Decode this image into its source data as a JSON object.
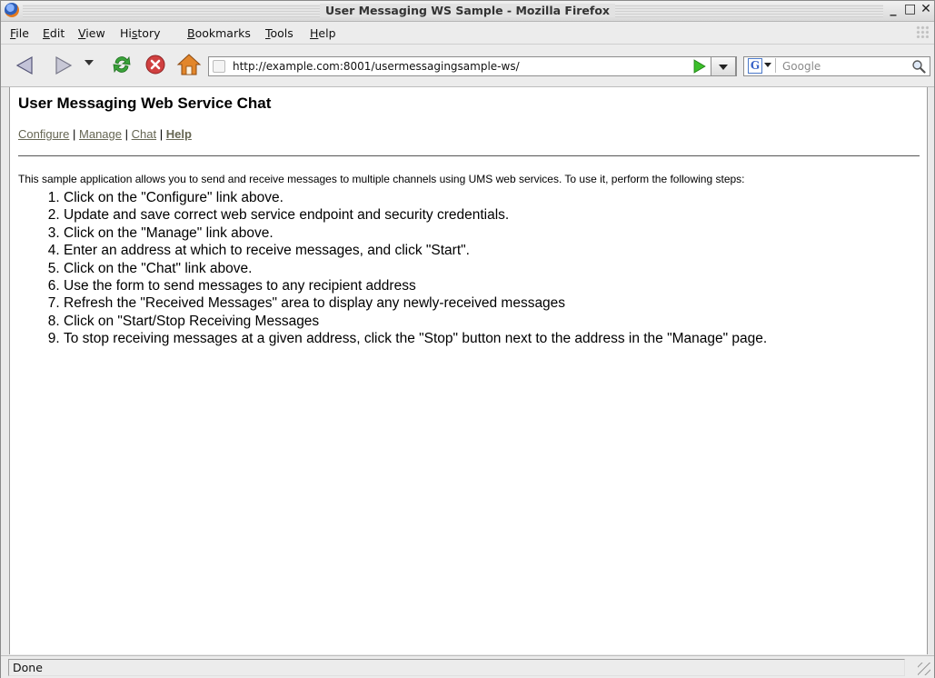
{
  "window": {
    "title": "User Messaging WS Sample - Mozilla Firefox",
    "controls": {
      "minimize": "_",
      "maximize": "□",
      "close": "✕"
    }
  },
  "menu": {
    "items": [
      "File",
      "Edit",
      "View",
      "History",
      "Bookmarks",
      "Tools",
      "Help"
    ]
  },
  "toolbar": {
    "url": "http://example.com:8001/usermessagingsample-ws/",
    "search_placeholder": "Google",
    "search_engine_letter": "G",
    "icons": [
      "back-icon",
      "forward-icon",
      "history-dropdown-icon",
      "reload-icon",
      "stop-icon",
      "home-icon",
      "go-icon",
      "search-icon"
    ]
  },
  "page": {
    "heading": "User Messaging Web Service Chat",
    "links": [
      {
        "label": "Configure"
      },
      {
        "label": "Manage"
      },
      {
        "label": "Chat"
      },
      {
        "label": "Help",
        "active": true
      }
    ],
    "separator": "|",
    "intro": "This sample application allows you to send and receive messages to multiple channels using UMS web services. To use it, perform the following steps:",
    "steps": [
      "Click on the \"Configure\" link above.",
      "Update and save correct web service endpoint and security credentials.",
      "Click on the \"Manage\" link above.",
      "Enter an address at which to receive messages, and click \"Start\".",
      "Click on the \"Chat\" link above.",
      "Use the form to send messages to any recipient address",
      "Refresh the \"Received Messages\" area to display any newly-received messages",
      "Click on \"Start/Stop Receiving Messages",
      "To stop receiving messages at a given address, click the \"Stop\" button next to the address in the \"Manage\" page."
    ]
  },
  "status": {
    "text": "Done"
  },
  "colors": {
    "link": "#666653",
    "chrome": "#ececec",
    "reload_green": "#3aa33a",
    "stop_red": "#d04040",
    "home_orange": "#e2862b",
    "go_green": "#3bbf2a"
  }
}
